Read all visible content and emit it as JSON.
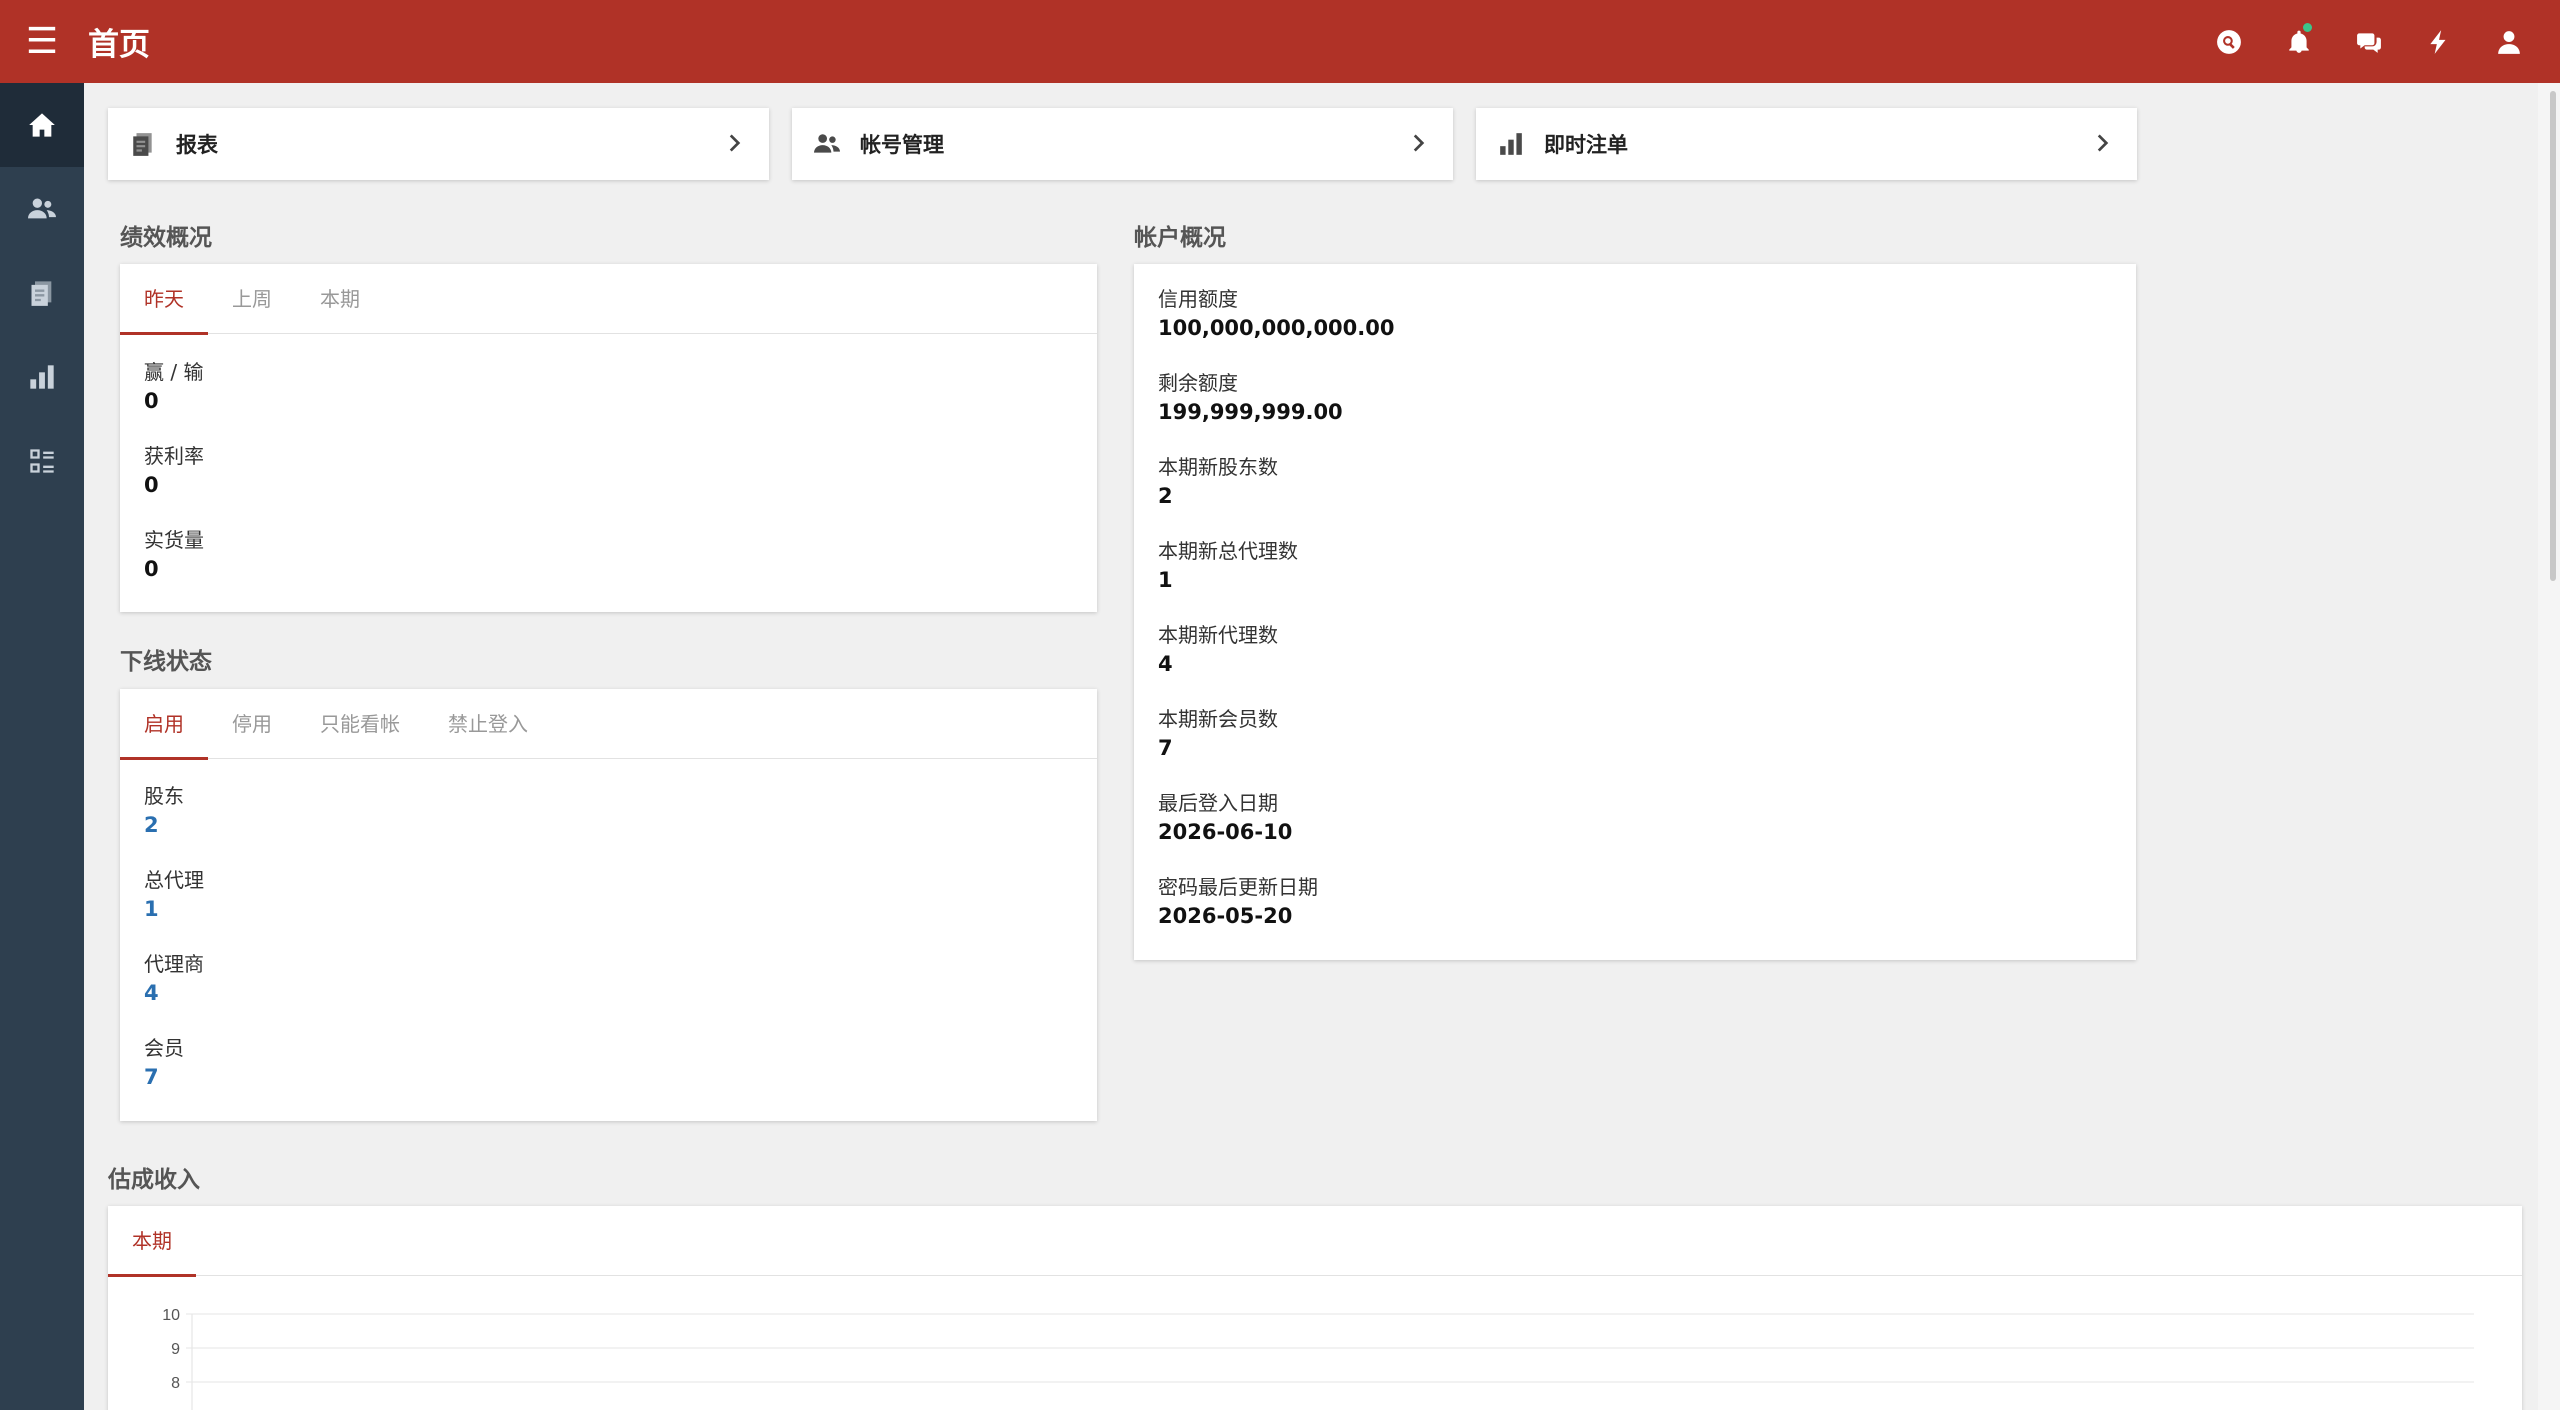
{
  "header": {
    "title": "首页"
  },
  "quick_links": [
    {
      "label": "报表"
    },
    {
      "label": "帐号管理"
    },
    {
      "label": "即时注单"
    }
  ],
  "performance": {
    "title": "绩效概况",
    "tabs": [
      "昨天",
      "上周",
      "本期"
    ],
    "active_tab": "昨天",
    "stats": [
      {
        "label": "赢 / 输",
        "value": "0"
      },
      {
        "label": "获利率",
        "value": "0"
      },
      {
        "label": "实货量",
        "value": "0"
      }
    ]
  },
  "downline": {
    "title": "下线状态",
    "tabs": [
      "启用",
      "停用",
      "只能看帐",
      "禁止登入"
    ],
    "active_tab": "启用",
    "stats": [
      {
        "label": "股东",
        "value": "2"
      },
      {
        "label": "总代理",
        "value": "1"
      },
      {
        "label": "代理商",
        "value": "4"
      },
      {
        "label": "会员",
        "value": "7"
      }
    ]
  },
  "account": {
    "title": "帐户概况",
    "stats": [
      {
        "label": "信用额度",
        "value": "100,000,000,000.00"
      },
      {
        "label": "剩余额度",
        "value": "199,999,999.00"
      },
      {
        "label": "本期新股东数",
        "value": "2"
      },
      {
        "label": "本期新总代理数",
        "value": "1"
      },
      {
        "label": "本期新代理数",
        "value": "4"
      },
      {
        "label": "本期新会员数",
        "value": "7"
      },
      {
        "label": "最后登入日期",
        "value": "2026-06-10"
      },
      {
        "label": "密码最后更新日期",
        "value": "2026-05-20"
      }
    ]
  },
  "income": {
    "title": "估成收入",
    "tabs": [
      "本期"
    ],
    "active_tab": "本期"
  },
  "chart_data": {
    "type": "line",
    "title": "",
    "xlabel": "",
    "ylabel": "",
    "y_ticks": [
      "10",
      "9",
      "8"
    ],
    "ylim": [
      0,
      10
    ],
    "grid": true,
    "series": []
  },
  "colors": {
    "header": "#b03227",
    "sidebar": "#2e3f4f",
    "accent": "#b03227",
    "link": "#2a6fb0",
    "notification_dot": "#3cc48a"
  },
  "icons": {
    "topbar": [
      "search-icon",
      "bell-icon",
      "chat-icon",
      "bolt-icon",
      "user-icon"
    ],
    "sidebar": [
      "home-icon",
      "users-icon",
      "report-icon",
      "bar-chart-icon",
      "list-icon"
    ]
  }
}
